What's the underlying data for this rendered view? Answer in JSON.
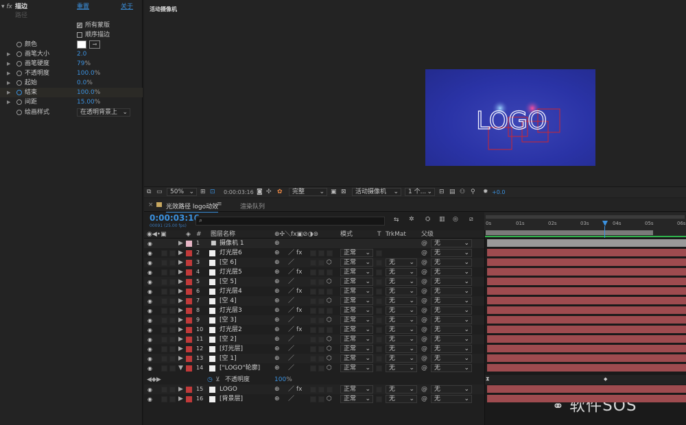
{
  "effects": {
    "name": "描边",
    "reset": "重置",
    "about": "关于",
    "path_label": "路径",
    "all_masks": "所有蒙版",
    "sequential": "顺序描边",
    "color_label": "颜色",
    "props": [
      {
        "label": "画笔大小",
        "value": "2.0",
        "unit": ""
      },
      {
        "label": "画笔硬度",
        "value": "79",
        "unit": "%"
      },
      {
        "label": "不透明度",
        "value": "100.0",
        "unit": "%"
      },
      {
        "label": "起始",
        "value": "0.0",
        "unit": "%"
      },
      {
        "label": "结束",
        "value": "100.0",
        "unit": "%"
      },
      {
        "label": "间距",
        "value": "15.00",
        "unit": "%"
      }
    ],
    "paint_style_label": "绘画样式",
    "paint_style_value": "在透明背景上"
  },
  "viewer": {
    "camera_label": "活动摄像机",
    "logo_text": "LOGO"
  },
  "viewer_toolbar": {
    "zoom": "50%",
    "timecode": "0:00:03:16",
    "resolution": "完整",
    "view": "活动摄像机",
    "views": "1 个...",
    "exposure": "+0.0"
  },
  "timeline": {
    "tab_comp": "光效路径 logo动效",
    "tab_render": "渲染队列",
    "timecode": "0:00:03:16",
    "frames": "00091 (25.00 fps)",
    "search_placeholder": "",
    "headers": {
      "num": "#",
      "name": "图层名称",
      "mode": "模式",
      "t": "T",
      "trkmat": "TrkMat",
      "parent": "父级"
    },
    "ticks": [
      "0s",
      "01s",
      "02s",
      "03s",
      "04s",
      "05s",
      "06s"
    ],
    "opacity_prop_label": "不透明度",
    "opacity_prop_value": "100",
    "opacity_prop_unit": "%",
    "layers": [
      {
        "num": "1",
        "name": "摄像机 1",
        "mode": "",
        "trkmat": "",
        "parent": "无",
        "label_color": "#e7b6c6"
      },
      {
        "num": "2",
        "name": "灯光层6",
        "mode": "正常",
        "trkmat": "",
        "parent": "无",
        "label_color": "#c13a3a"
      },
      {
        "num": "3",
        "name": "[空 6]",
        "mode": "正常",
        "trkmat": "无",
        "parent": "无",
        "label_color": "#c13a3a"
      },
      {
        "num": "4",
        "name": "灯光层5",
        "mode": "正常",
        "trkmat": "无",
        "parent": "无",
        "label_color": "#c13a3a"
      },
      {
        "num": "5",
        "name": "[空 5]",
        "mode": "正常",
        "trkmat": "无",
        "parent": "无",
        "label_color": "#c13a3a"
      },
      {
        "num": "6",
        "name": "灯光层4",
        "mode": "正常",
        "trkmat": "无",
        "parent": "无",
        "label_color": "#c13a3a"
      },
      {
        "num": "7",
        "name": "[空 4]",
        "mode": "正常",
        "trkmat": "无",
        "parent": "无",
        "label_color": "#c13a3a"
      },
      {
        "num": "8",
        "name": "灯光层3",
        "mode": "正常",
        "trkmat": "无",
        "parent": "无",
        "label_color": "#c13a3a"
      },
      {
        "num": "9",
        "name": "[空 3]",
        "mode": "正常",
        "trkmat": "无",
        "parent": "无",
        "label_color": "#c13a3a"
      },
      {
        "num": "10",
        "name": "灯光层2",
        "mode": "正常",
        "trkmat": "无",
        "parent": "无",
        "label_color": "#c13a3a"
      },
      {
        "num": "11",
        "name": "[空 2]",
        "mode": "正常",
        "trkmat": "无",
        "parent": "无",
        "label_color": "#c13a3a"
      },
      {
        "num": "12",
        "name": "[灯光层]",
        "mode": "正常",
        "trkmat": "无",
        "parent": "无",
        "label_color": "#c13a3a"
      },
      {
        "num": "13",
        "name": "[空 1]",
        "mode": "正常",
        "trkmat": "无",
        "parent": "无",
        "label_color": "#c13a3a"
      },
      {
        "num": "14",
        "name": "[\"LOGO\"轮廓]",
        "mode": "正常",
        "trkmat": "无",
        "parent": "无",
        "label_color": "#c13a3a"
      },
      {
        "num": "15",
        "name": "LOGO",
        "mode": "正常",
        "trkmat": "无",
        "parent": "无",
        "label_color": "#c13a3a"
      },
      {
        "num": "16",
        "name": "[背景层]",
        "mode": "正常",
        "trkmat": "无",
        "parent": "无",
        "label_color": "#c13a3a"
      }
    ]
  },
  "watermark": "软件SOS",
  "colors": {
    "accent": "#3b92e0",
    "layer_bar": "#9e4b4f",
    "camera_bar": "#9a9a9a",
    "work_area": "#2fb24c"
  }
}
